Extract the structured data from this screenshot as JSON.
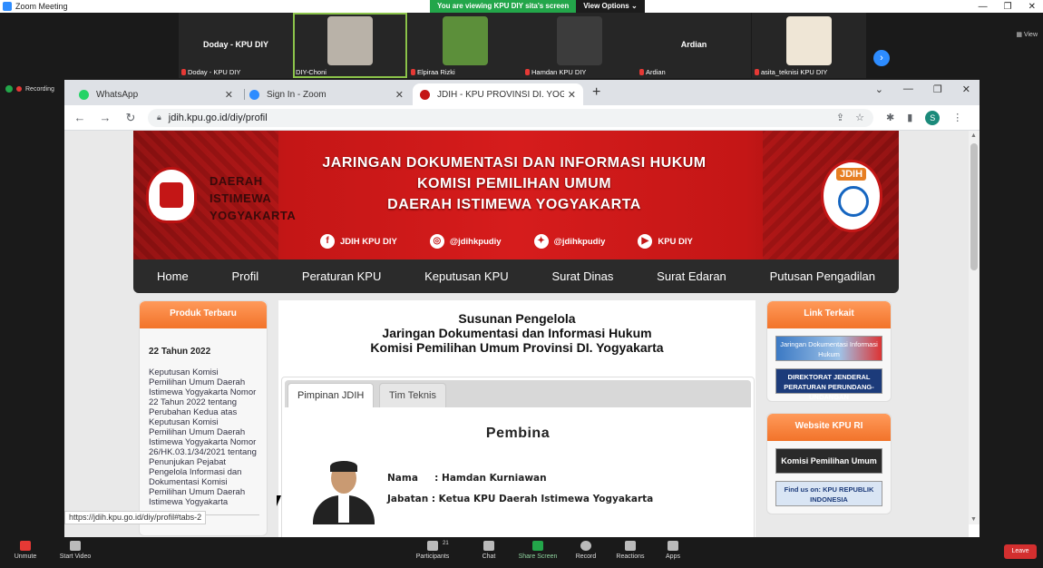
{
  "zoom": {
    "window_title": "Zoom Meeting",
    "viewing_banner": "You are viewing KPU DIY sita's screen",
    "view_options": "View Options",
    "view_label": "View",
    "recording": "Recording",
    "participants_thumbs": [
      {
        "center_name": "Doday - KPU DIY",
        "label": "Doday - KPU DIY"
      },
      {
        "center_name": "",
        "label": "DIY-Choni"
      },
      {
        "center_name": "",
        "label": "Elpiraa Rizki"
      },
      {
        "center_name": "",
        "label": "Hamdan KPU DIY"
      },
      {
        "center_name": "Ardian",
        "label": "Ardian"
      },
      {
        "center_name": "",
        "label": "asita_teknisi KPU DIY"
      }
    ],
    "controls": {
      "unmute": "Unmute",
      "start_video": "Start Video",
      "participants": "Participants",
      "participants_count": "21",
      "chat": "Chat",
      "share_screen": "Share Screen",
      "record": "Record",
      "reactions": "Reactions",
      "apps": "Apps",
      "leave": "Leave"
    }
  },
  "browser": {
    "tabs": [
      {
        "title": "WhatsApp",
        "color": "#25d366"
      },
      {
        "title": "Sign In - Zoom",
        "color": "#2d8cff"
      },
      {
        "title": "JDIH - KPU PROVINSI DI. YOGYAK",
        "color": "#c41616"
      }
    ],
    "url": "jdih.kpu.go.id/diy/profil",
    "avatar_letter": "S",
    "status_url": "https://jdih.kpu.go.id/diy/profil#tabs-2"
  },
  "site": {
    "region_lines": [
      "DAERAH",
      "ISTIMEWA",
      "YOGYAKARTA"
    ],
    "banner_titles": [
      "JARINGAN DOKUMENTASI DAN INFORMASI HUKUM",
      "KOMISI PEMILIHAN UMUM",
      "DAERAH ISTIMEWA YOGYAKARTA"
    ],
    "social": [
      {
        "icon": "facebook-icon",
        "glyph": "f",
        "label": "JDIH KPU DIY"
      },
      {
        "icon": "instagram-icon",
        "glyph": "◎",
        "label": "@jdihkpudiy"
      },
      {
        "icon": "twitter-icon",
        "glyph": "✦",
        "label": "@jdihkpudiy"
      },
      {
        "icon": "youtube-icon",
        "glyph": "▶",
        "label": "KPU DIY"
      }
    ],
    "jdih_badge": "JDIH",
    "menu": [
      "Home",
      "Profil",
      "Peraturan KPU",
      "Keputusan KPU",
      "Surat Dinas",
      "Surat Edaran",
      "Putusan Pengadilan"
    ],
    "left_box": {
      "title": "Produk Terbaru",
      "date": "22 Tahun 2022",
      "desc": "Keputusan Komisi Pemilihan Umum Daerah Istimewa Yogyakarta Nomor 22 Tahun 2022 tentang Perubahan Kedua atas Keputusan Komisi Pemilihan Umum Daerah Istimewa Yogyakarta Nomor 26/HK.03.1/34/2021 tentang Penunjukan Pejabat Pengelola Informasi dan Dokumentasi Komisi Pemilihan Umum Daerah Istimewa Yogyakarta"
    },
    "center": {
      "heading": [
        "Susunan Pengelola",
        "Jaringan Dokumentasi dan Informasi Hukum",
        "Komisi Pemilihan Umum Provinsi DI. Yogyakarta"
      ],
      "tabs": [
        "Pimpinan JDIH",
        "Tim Teknis"
      ],
      "section_title": "Pembina",
      "name_line": "Nama     : Hamdan Kurniawan",
      "jabatan_line": "Jabatan : Ketua KPU Daerah Istimewa Yogyakarta"
    },
    "right": {
      "link_title": "Link Terkait",
      "link_items": [
        "Jaringan Dokumentasi Informasi Hukum",
        "DIREKTORAT JENDERAL PERATURAN PERUNDANG-UNDANGAN"
      ],
      "website_title": "Website KPU RI",
      "website_items": [
        "Komisi Pemilihan Umum",
        "Find us on: KPU REPUBLIK INDONESIA"
      ]
    }
  }
}
